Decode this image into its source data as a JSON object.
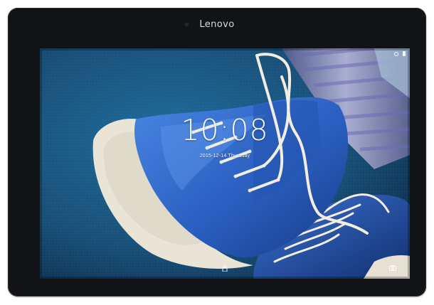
{
  "device": {
    "brand": "Lenovo"
  },
  "lockscreen": {
    "time": "10:08",
    "date": "2015-12-14 Thursday",
    "icons": {
      "lock": "lock-icon",
      "camera": "camera-icon",
      "alarm": "alarm-icon",
      "battery": "battery-icon"
    }
  },
  "colors": {
    "bezel": "#111316",
    "shoe_blue": "#2a5fc0",
    "sole": "#e9e4d6",
    "background_fabric": "#1d5a86"
  }
}
